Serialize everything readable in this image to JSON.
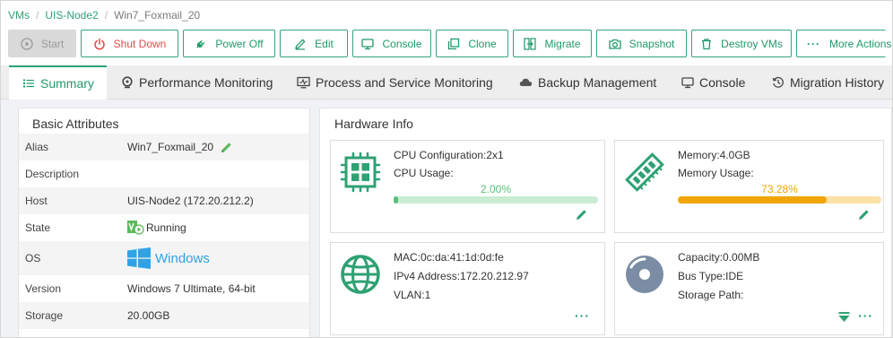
{
  "breadcrumb": [
    "VMs",
    "UIS-Node2",
    "Win7_Foxmail_20"
  ],
  "toolbar": {
    "start": "Start",
    "shutdown": "Shut Down",
    "poweroff": "Power Off",
    "edit": "Edit",
    "console": "Console",
    "clone": "Clone",
    "migrate": "Migrate",
    "snapshot": "Snapshot",
    "destroy": "Destroy VMs",
    "more": "More Actions"
  },
  "tabs": {
    "summary": "Summary",
    "performance": "Performance Monitoring",
    "process": "Process and Service Monitoring",
    "backup": "Backup Management",
    "console": "Console",
    "migration": "Migration History"
  },
  "basic": {
    "title": "Basic Attributes",
    "rows": [
      {
        "key": "Alias",
        "value": "Win7_Foxmail_20"
      },
      {
        "key": "Description",
        "value": ""
      },
      {
        "key": "Host",
        "value": "UIS-Node2 (172.20.212.2)"
      },
      {
        "key": "State",
        "value": "Running"
      },
      {
        "key": "OS",
        "value": "Windows"
      },
      {
        "key": "Version",
        "value": "Windows 7 Ultimate, 64-bit"
      },
      {
        "key": "Storage",
        "value": "20.00GB"
      }
    ]
  },
  "hardware": {
    "title": "Hardware Info",
    "cpu": {
      "config": "CPU Configuration:2x1",
      "usage_label": "CPU Usage:",
      "usage_text": "2.00%",
      "usage": 0.02
    },
    "memory": {
      "size": "Memory:4.0GB",
      "usage_label": "Memory Usage:",
      "usage_text": "73.28%",
      "usage": 0.7328
    },
    "network": {
      "mac": "MAC:0c:da:41:1d:0d:fe",
      "ipv4": "IPv4 Address:172.20.212.97",
      "vlan": "VLAN:1"
    },
    "disk": {
      "capacity": "Capacity:0.00MB",
      "bus": "Bus Type:IDE",
      "path": "Storage Path:"
    }
  },
  "colors": {
    "accent": "#1f9a6a",
    "cpu_bar": "#5cbf7a",
    "mem_bar": "#f0a500",
    "danger": "#e04a4a"
  }
}
